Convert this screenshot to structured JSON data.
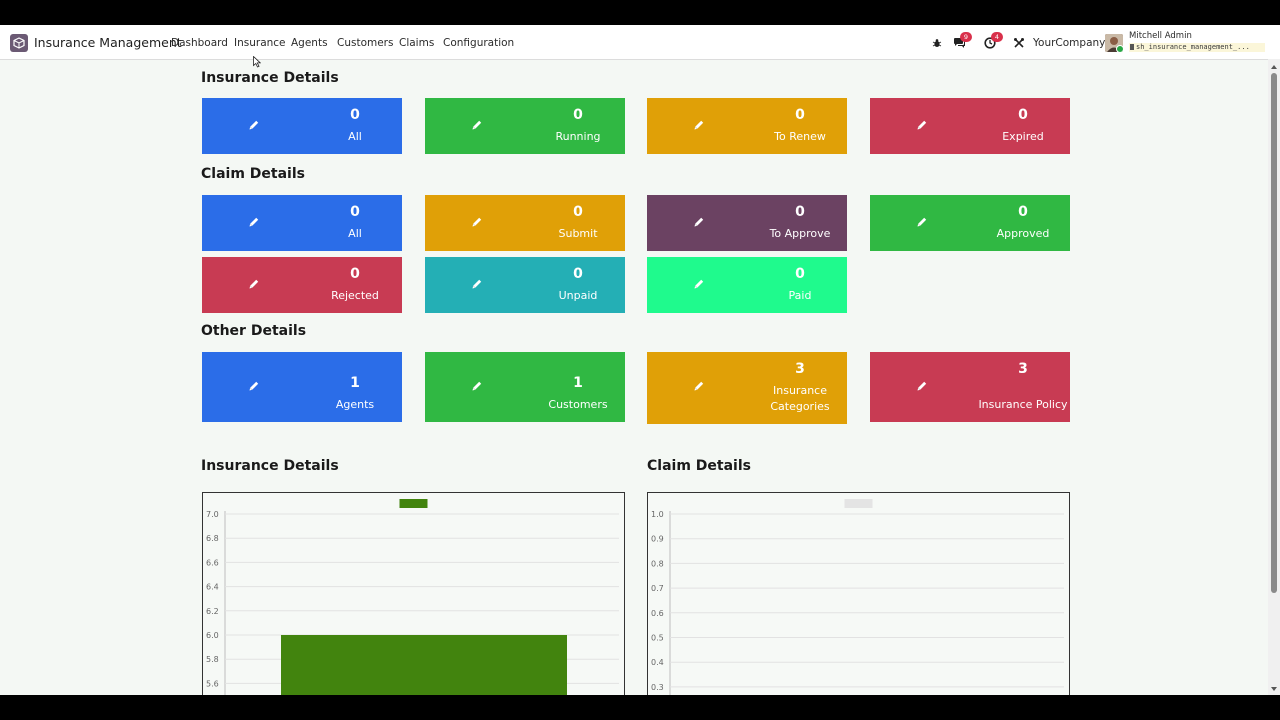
{
  "app": {
    "title": "Insurance Management"
  },
  "nav": [
    "Dashboard",
    "Insurance",
    "Agents",
    "Customers",
    "Claims",
    "Configuration"
  ],
  "systray": {
    "messages_count": "9",
    "activities_count": "4",
    "company": "YourCompany",
    "user_name": "Mitchell Admin",
    "db_name": "sh_insurance_management_..."
  },
  "sections": {
    "insurance": "Insurance Details",
    "claim": "Claim Details",
    "other": "Other Details"
  },
  "insurance_tiles": [
    {
      "count": "0",
      "label": "All",
      "color": "#2b6de8"
    },
    {
      "count": "0",
      "label": "Running",
      "color": "#30b843"
    },
    {
      "count": "0",
      "label": "To Renew",
      "color": "#e0a007"
    },
    {
      "count": "0",
      "label": "Expired",
      "color": "#c83b53"
    }
  ],
  "claim_tiles": [
    {
      "count": "0",
      "label": "All",
      "color": "#2b6de8"
    },
    {
      "count": "0",
      "label": "Submit",
      "color": "#e0a007"
    },
    {
      "count": "0",
      "label": "To Approve",
      "color": "#6b4262"
    },
    {
      "count": "0",
      "label": "Approved",
      "color": "#30b843"
    },
    {
      "count": "0",
      "label": "Rejected",
      "color": "#c83b53"
    },
    {
      "count": "0",
      "label": "Unpaid",
      "color": "#24afb5"
    },
    {
      "count": "0",
      "label": "Paid",
      "color": "#1ffa8d"
    }
  ],
  "other_tiles": [
    {
      "count": "1",
      "label": "Agents",
      "color": "#2b6de8"
    },
    {
      "count": "1",
      "label": "Customers",
      "color": "#30b843"
    },
    {
      "count": "3",
      "label": "Insurance Categories",
      "color": "#e0a007"
    },
    {
      "count": "3",
      "label": "Insurance Policy",
      "color": "#c83b53"
    }
  ],
  "charts_titles": {
    "insurance": "Insurance Details",
    "claim": "Claim Details"
  },
  "chart_data": [
    {
      "type": "bar",
      "title": "",
      "categories": [
        ""
      ],
      "series": [
        {
          "values": [
            6
          ],
          "color": "#42840e"
        }
      ],
      "yticks": [
        "7.0",
        "6.8",
        "6.6",
        "6.4",
        "6.2",
        "6.0",
        "5.8",
        "5.6"
      ],
      "ylim": [
        5.5,
        7.1
      ],
      "legend": "top-center",
      "grid": true
    },
    {
      "type": "bar",
      "title": "",
      "categories": [
        ""
      ],
      "series": [
        {
          "values": [],
          "color": "#e4e4e4"
        }
      ],
      "yticks": [
        "1.0",
        "0.9",
        "0.8",
        "0.7",
        "0.6",
        "0.5",
        "0.4",
        "0.3"
      ],
      "ylim": [
        0.28,
        1.02
      ],
      "legend": "top-center",
      "grid": true
    }
  ]
}
